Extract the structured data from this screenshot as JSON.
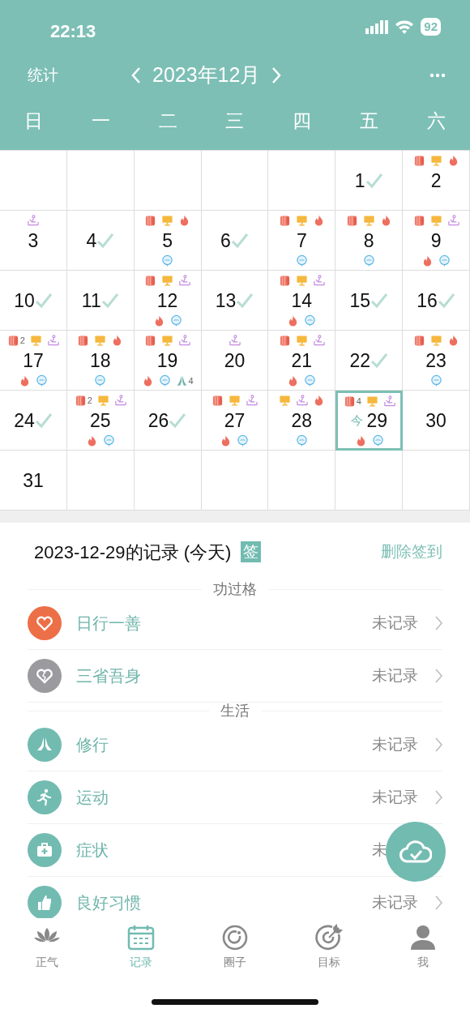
{
  "status_bar": {
    "time": "22:13",
    "battery": "92"
  },
  "header": {
    "left": "统计",
    "month": "2023年12月"
  },
  "weekdays": [
    "日",
    "一",
    "二",
    "三",
    "四",
    "五",
    "六"
  ],
  "calendar": [
    {
      "kind": "blank"
    },
    {
      "kind": "blank"
    },
    {
      "kind": "blank"
    },
    {
      "kind": "blank"
    },
    {
      "kind": "blank"
    },
    {
      "kind": "day",
      "day": "1",
      "checked": true,
      "selected": false
    },
    {
      "kind": "day",
      "day": "2",
      "checked": false,
      "selected": false,
      "top": [
        {
          "kind": "roll"
        },
        {
          "kind": "screen"
        },
        {
          "kind": "fire"
        }
      ]
    },
    {
      "kind": "day",
      "day": "3",
      "checked": false,
      "selected": false,
      "top": [
        {
          "kind": "meditate"
        }
      ]
    },
    {
      "kind": "day",
      "day": "4",
      "checked": true,
      "selected": false
    },
    {
      "kind": "day",
      "day": "5",
      "checked": false,
      "selected": false,
      "top": [
        {
          "kind": "roll"
        },
        {
          "kind": "screen"
        },
        {
          "kind": "fire"
        }
      ],
      "bottom": [
        {
          "kind": "chat"
        }
      ]
    },
    {
      "kind": "day",
      "day": "6",
      "checked": true,
      "selected": false
    },
    {
      "kind": "day",
      "day": "7",
      "checked": false,
      "selected": false,
      "top": [
        {
          "kind": "roll"
        },
        {
          "kind": "screen"
        },
        {
          "kind": "fire"
        }
      ],
      "bottom": [
        {
          "kind": "chat"
        }
      ]
    },
    {
      "kind": "day",
      "day": "8",
      "checked": false,
      "selected": false,
      "top": [
        {
          "kind": "roll"
        },
        {
          "kind": "screen"
        },
        {
          "kind": "fire"
        }
      ],
      "bottom": [
        {
          "kind": "chat"
        }
      ]
    },
    {
      "kind": "day",
      "day": "9",
      "checked": false,
      "selected": false,
      "top": [
        {
          "kind": "roll"
        },
        {
          "kind": "screen"
        },
        {
          "kind": "meditate"
        }
      ],
      "bottom": [
        {
          "kind": "fire"
        },
        {
          "kind": "chat"
        }
      ]
    },
    {
      "kind": "day",
      "day": "10",
      "checked": true,
      "selected": false
    },
    {
      "kind": "day",
      "day": "11",
      "checked": true,
      "selected": false
    },
    {
      "kind": "day",
      "day": "12",
      "checked": false,
      "selected": false,
      "top": [
        {
          "kind": "roll"
        },
        {
          "kind": "screen"
        },
        {
          "kind": "meditate"
        }
      ],
      "bottom": [
        {
          "kind": "fire"
        },
        {
          "kind": "chat"
        }
      ]
    },
    {
      "kind": "day",
      "day": "13",
      "checked": true,
      "selected": false
    },
    {
      "kind": "day",
      "day": "14",
      "checked": false,
      "selected": false,
      "top": [
        {
          "kind": "roll"
        },
        {
          "kind": "screen"
        },
        {
          "kind": "meditate"
        }
      ],
      "bottom": [
        {
          "kind": "fire"
        },
        {
          "kind": "chat"
        }
      ]
    },
    {
      "kind": "day",
      "day": "15",
      "checked": true,
      "selected": false
    },
    {
      "kind": "day",
      "day": "16",
      "checked": true,
      "selected": false
    },
    {
      "kind": "day",
      "day": "17",
      "checked": false,
      "selected": false,
      "top": [
        {
          "kind": "roll",
          "count": "2"
        },
        {
          "kind": "screen"
        },
        {
          "kind": "meditate"
        }
      ],
      "bottom": [
        {
          "kind": "fire"
        },
        {
          "kind": "chat"
        }
      ]
    },
    {
      "kind": "day",
      "day": "18",
      "checked": false,
      "selected": false,
      "top": [
        {
          "kind": "roll"
        },
        {
          "kind": "screen"
        },
        {
          "kind": "fire"
        }
      ],
      "bottom": [
        {
          "kind": "chat"
        }
      ]
    },
    {
      "kind": "day",
      "day": "19",
      "checked": false,
      "selected": false,
      "top": [
        {
          "kind": "roll"
        },
        {
          "kind": "screen"
        },
        {
          "kind": "meditate"
        }
      ],
      "bottom": [
        {
          "kind": "fire"
        },
        {
          "kind": "chat"
        },
        {
          "kind": "pray",
          "count": "4"
        }
      ]
    },
    {
      "kind": "day",
      "day": "20",
      "checked": false,
      "selected": false,
      "top": [
        {
          "kind": "meditate"
        }
      ]
    },
    {
      "kind": "day",
      "day": "21",
      "checked": false,
      "selected": false,
      "top": [
        {
          "kind": "roll"
        },
        {
          "kind": "screen"
        },
        {
          "kind": "meditate"
        }
      ],
      "bottom": [
        {
          "kind": "fire"
        },
        {
          "kind": "chat"
        }
      ]
    },
    {
      "kind": "day",
      "day": "22",
      "checked": true,
      "selected": false
    },
    {
      "kind": "day",
      "day": "23",
      "checked": false,
      "selected": false,
      "top": [
        {
          "kind": "roll"
        },
        {
          "kind": "screen"
        },
        {
          "kind": "fire"
        }
      ],
      "bottom": [
        {
          "kind": "chat"
        }
      ]
    },
    {
      "kind": "day",
      "day": "24",
      "checked": true,
      "selected": false
    },
    {
      "kind": "day",
      "day": "25",
      "checked": false,
      "selected": false,
      "top": [
        {
          "kind": "roll",
          "count": "2"
        },
        {
          "kind": "screen"
        },
        {
          "kind": "meditate"
        }
      ],
      "bottom": [
        {
          "kind": "fire"
        },
        {
          "kind": "chat"
        }
      ]
    },
    {
      "kind": "day",
      "day": "26",
      "checked": true,
      "selected": false
    },
    {
      "kind": "day",
      "day": "27",
      "checked": false,
      "selected": false,
      "top": [
        {
          "kind": "roll"
        },
        {
          "kind": "screen"
        },
        {
          "kind": "meditate"
        }
      ],
      "bottom": [
        {
          "kind": "fire"
        },
        {
          "kind": "chat"
        }
      ]
    },
    {
      "kind": "day",
      "day": "28",
      "checked": false,
      "selected": false,
      "top": [
        {
          "kind": "screen"
        },
        {
          "kind": "meditate"
        },
        {
          "kind": "fire"
        }
      ],
      "bottom": [
        {
          "kind": "chat"
        }
      ]
    },
    {
      "kind": "day",
      "day": "29",
      "checked": false,
      "selected": true,
      "today": "今",
      "top": [
        {
          "kind": "roll",
          "count": "4"
        },
        {
          "kind": "screen"
        },
        {
          "kind": "meditate"
        }
      ],
      "bottom": [
        {
          "kind": "fire"
        },
        {
          "kind": "chat"
        }
      ]
    },
    {
      "kind": "day",
      "day": "30",
      "checked": false,
      "selected": false
    },
    {
      "kind": "day",
      "day": "31",
      "checked": false,
      "selected": false
    },
    {
      "kind": "blank"
    },
    {
      "kind": "blank"
    },
    {
      "kind": "blank"
    },
    {
      "kind": "blank"
    },
    {
      "kind": "blank"
    },
    {
      "kind": "blank"
    }
  ],
  "record": {
    "title": "2023-12-29的记录 (今天)",
    "badge": "签",
    "action": "删除签到",
    "groups": [
      {
        "heading": "功过格",
        "items": [
          {
            "color": "#ec6f47",
            "label": "日行一善",
            "status": "未记录",
            "chevron": true
          },
          {
            "color": "#9b9b9f",
            "label": "三省吾身",
            "status": "未记录",
            "chevron": true
          }
        ]
      },
      {
        "heading": "生活",
        "items": [
          {
            "color": "#72bbb1",
            "label": "修行",
            "status": "未记录",
            "chevron": true
          },
          {
            "color": "#72bbb1",
            "label": "运动",
            "status": "未记录",
            "chevron": true
          },
          {
            "color": "#72bbb1",
            "label": "症状",
            "status": "未",
            "chevron": false
          },
          {
            "color": "#72bbb1",
            "label": "良好习惯",
            "status": "未记录",
            "chevron": true
          }
        ]
      }
    ]
  },
  "tabs": [
    {
      "label": "正气",
      "selected": false
    },
    {
      "label": "记录",
      "selected": true
    },
    {
      "label": "圈子",
      "selected": false
    },
    {
      "label": "目标",
      "selected": false
    },
    {
      "label": "我",
      "selected": false
    }
  ]
}
